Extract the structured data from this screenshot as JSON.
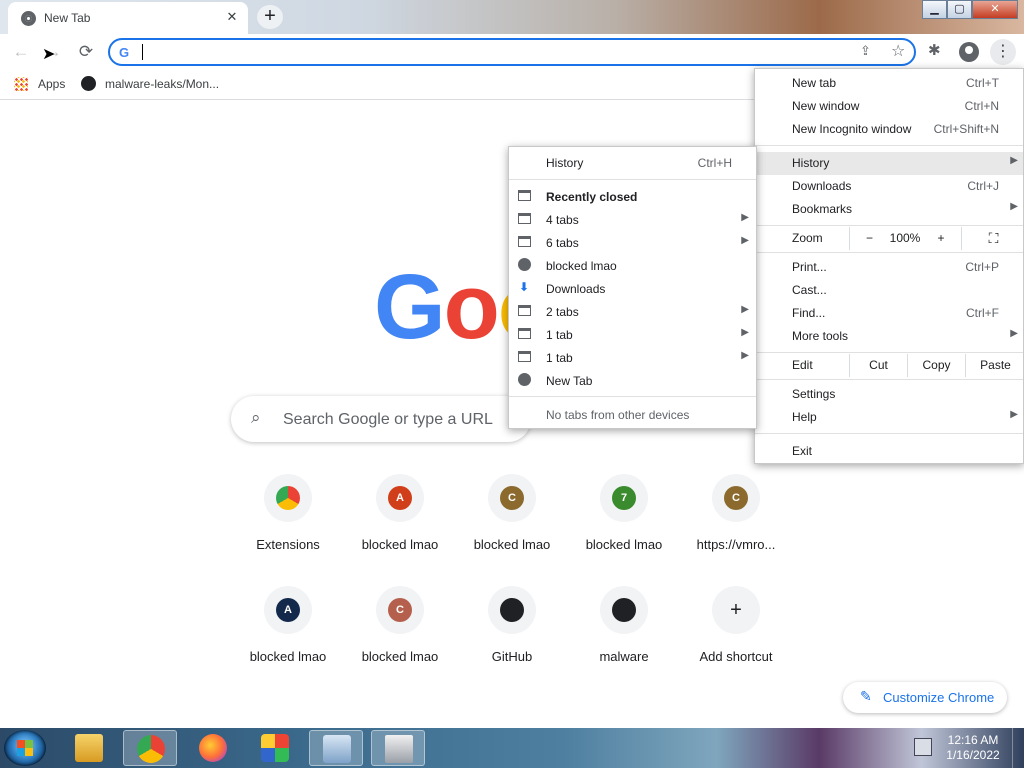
{
  "tab": {
    "title": "New Tab",
    "close_glyph": "✕",
    "new_glyph": "+"
  },
  "window_controls": {
    "minimize": "▁",
    "maximize": "▢",
    "close": "✕"
  },
  "toolbar": {
    "back": "←",
    "forward": "→",
    "reload": "⟳",
    "omnibox_value": "",
    "omnibox_icon": "G",
    "menu_glyph": "⋮"
  },
  "bookmarks": [
    {
      "label": "Apps",
      "icon": "apps-grid-icon"
    },
    {
      "label": "malware-leaks/Mon...",
      "icon": "github-icon"
    }
  ],
  "google_logo": {
    "g": "G",
    "o1": "o",
    "o2": "o"
  },
  "search": {
    "placeholder": "Search Google or type a URL"
  },
  "shortcuts": [
    {
      "label": "Extensions",
      "letter": "",
      "color": "#f1f3f4",
      "icon": "chrome-icon"
    },
    {
      "label": "blocked lmao",
      "letter": "A",
      "color": "#d03f1a"
    },
    {
      "label": "blocked lmao",
      "letter": "C",
      "color": "#8c6a2e"
    },
    {
      "label": "blocked lmao",
      "letter": "7",
      "color": "#3a8a2e"
    },
    {
      "label": "https://vmro...",
      "letter": "C",
      "color": "#8c6a2e"
    },
    {
      "label": "blocked lmao",
      "letter": "A",
      "color": "#13294b"
    },
    {
      "label": "blocked lmao",
      "letter": "C",
      "color": "#b5604c"
    },
    {
      "label": "GitHub",
      "letter": "",
      "color": "#202124",
      "icon": "github-icon"
    },
    {
      "label": "malware",
      "letter": "",
      "color": "#202124",
      "icon": "github-icon"
    },
    {
      "label": "Add shortcut",
      "letter": "+",
      "color": "#f1f3f4",
      "icon": "plus-icon"
    }
  ],
  "customize": {
    "label": "Customize Chrome"
  },
  "main_menu": {
    "new_tab": {
      "label": "New tab",
      "shortcut": "Ctrl+T"
    },
    "new_window": {
      "label": "New window",
      "shortcut": "Ctrl+N"
    },
    "new_incognito": {
      "label": "New Incognito window",
      "shortcut": "Ctrl+Shift+N"
    },
    "history": {
      "label": "History"
    },
    "downloads": {
      "label": "Downloads",
      "shortcut": "Ctrl+J"
    },
    "bookmarks": {
      "label": "Bookmarks"
    },
    "zoom": {
      "label": "Zoom",
      "minus": "−",
      "value": "100%",
      "plus": "+"
    },
    "print": {
      "label": "Print...",
      "shortcut": "Ctrl+P"
    },
    "cast": {
      "label": "Cast..."
    },
    "find": {
      "label": "Find...",
      "shortcut": "Ctrl+F"
    },
    "more_tools": {
      "label": "More tools"
    },
    "edit": {
      "label": "Edit",
      "cut": "Cut",
      "copy": "Copy",
      "paste": "Paste"
    },
    "settings": {
      "label": "Settings"
    },
    "help": {
      "label": "Help"
    },
    "exit": {
      "label": "Exit"
    }
  },
  "history_menu": {
    "history": {
      "label": "History",
      "shortcut": "Ctrl+H"
    },
    "recently_closed": "Recently closed",
    "items": [
      {
        "label": "4 tabs",
        "icon": "tab-window-icon",
        "submenu": true
      },
      {
        "label": "6 tabs",
        "icon": "tab-window-icon",
        "submenu": true
      },
      {
        "label": "blocked lmao",
        "icon": "globe-icon",
        "submenu": false
      },
      {
        "label": "Downloads",
        "icon": "download-icon",
        "submenu": false
      },
      {
        "label": "2 tabs",
        "icon": "tab-window-icon",
        "submenu": true
      },
      {
        "label": "1 tab",
        "icon": "tab-window-icon",
        "submenu": true
      },
      {
        "label": "1 tab",
        "icon": "tab-window-icon",
        "submenu": true
      },
      {
        "label": "New Tab",
        "icon": "globe-icon",
        "submenu": false
      }
    ],
    "no_tabs": "No tabs from other devices"
  },
  "taskbar": {
    "clock_time": "12:16 AM",
    "clock_date": "1/16/2022",
    "apps": [
      "explorer-icon",
      "chrome-icon",
      "firefox-icon",
      "app-icon",
      "remote-desktop-icon",
      "file-icon"
    ]
  },
  "colors": {
    "accent": "#1a73e8",
    "menu_highlight": "#e8e8e8"
  }
}
